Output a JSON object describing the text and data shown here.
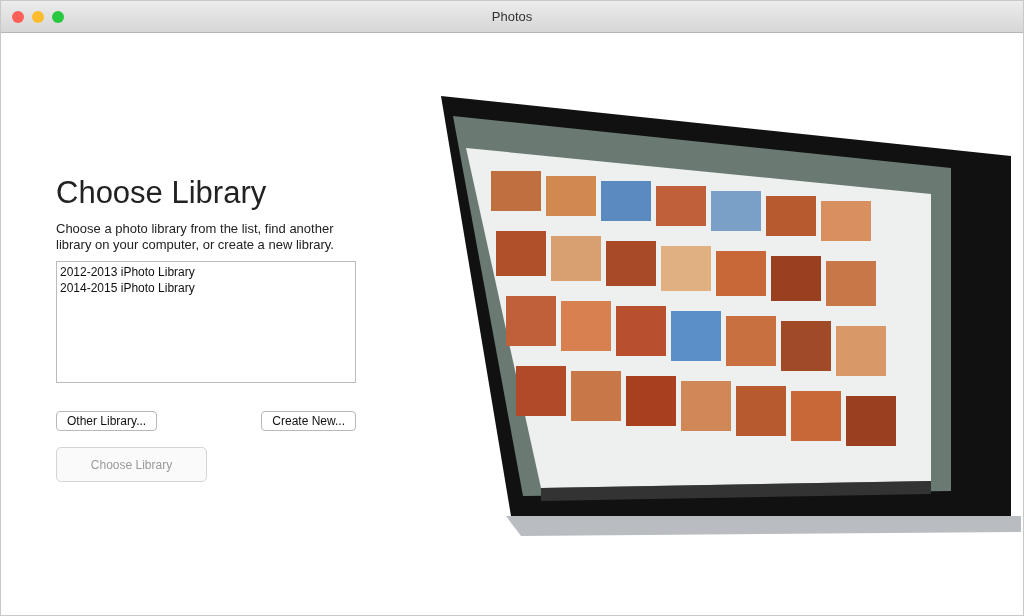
{
  "window": {
    "title": "Photos"
  },
  "heading": "Choose Library",
  "description": "Choose a photo library from the list, find another library on your computer, or create a new library.",
  "libraries": [
    {
      "name": "2012-2013 iPhoto Library",
      "selected": false
    },
    {
      "name": "2014-2015 iPhoto Library",
      "selected": false
    }
  ],
  "buttons": [
    {
      "label": "Other Library...",
      "kind": "secondary"
    },
    {
      "label": "Create New...",
      "kind": "secondary"
    }
  ],
  "primary_button": {
    "label": "Choose Library",
    "disabled": true
  }
}
